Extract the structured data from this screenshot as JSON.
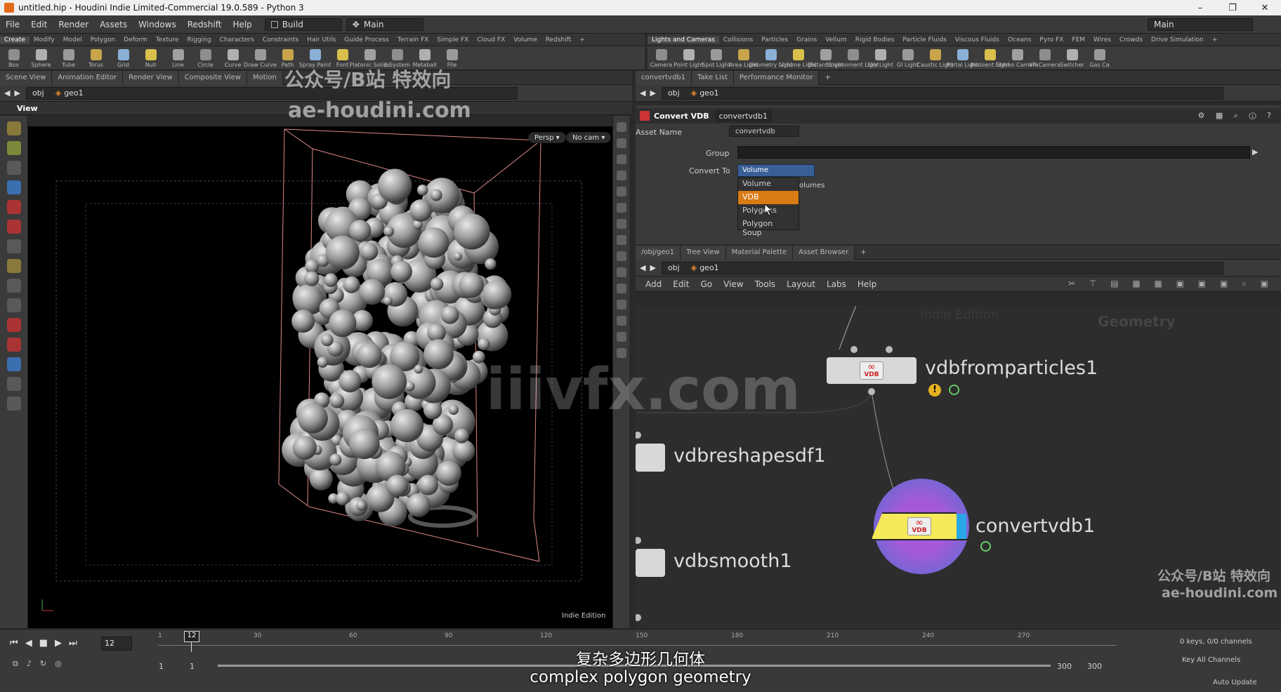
{
  "window": {
    "title": "untitled.hip - Houdini Indie Limited-Commercial 19.0.589 - Python 3",
    "controls": [
      "–",
      "❐",
      "✕"
    ]
  },
  "menubar": {
    "items": [
      "File",
      "Edit",
      "Render",
      "Assets",
      "Windows",
      "Redshift",
      "Help"
    ],
    "build": "Build",
    "desktop": "Main",
    "desktop_right": "Main"
  },
  "shelf_left": {
    "tabs": [
      "Create",
      "Modify",
      "Model",
      "Polygon",
      "Deform",
      "Texture",
      "Rigging",
      "Characters",
      "Constraints",
      "Hair Utils",
      "Guide Process",
      "Terrain FX",
      "Simple FX",
      "Cloud FX",
      "Volume",
      "Redshift"
    ],
    "tools": [
      "Box",
      "Sphere",
      "Tube",
      "Torus",
      "Grid",
      "Null",
      "Line",
      "Circle",
      "Curve",
      "Draw Curve",
      "Path",
      "Spray Paint",
      "Font",
      "Platonic Solids",
      "L-System",
      "Metaball",
      "File"
    ]
  },
  "shelf_right": {
    "tabs": [
      "Lights and Cameras",
      "Collisions",
      "Particles",
      "Grains",
      "Vellum",
      "Rigid Bodies",
      "Particle Fluids",
      "Viscous Fluids",
      "Oceans",
      "Pyro FX",
      "FEM",
      "Wires",
      "Crowds",
      "Drive Simulation"
    ],
    "tools": [
      "Camera",
      "Point Light",
      "Spot Light",
      "Area Light",
      "Geometry Light",
      "Volume Light",
      "Distant Light",
      "Environment Light",
      "Sky Light",
      "GI Light",
      "Caustic Light",
      "Portal Light",
      "Ambient Light",
      "Stereo Camera",
      "VR Camera",
      "Switcher",
      "Gas Ca"
    ]
  },
  "left_pane": {
    "tabs": [
      "Scene View",
      "Animation Editor",
      "Render View",
      "Composite View",
      "Motion"
    ],
    "path": [
      "obj",
      "geo1"
    ],
    "view_label": "View",
    "persp": "Persp ▾",
    "cam": "No cam ▾",
    "edition": "Indie Edition"
  },
  "param_pane": {
    "tabs": [
      "convertvdb1",
      "Take List",
      "Performance Monitor"
    ],
    "path": [
      "obj",
      "geo1"
    ],
    "node_type": "Convert VDB",
    "node_name": "convertvdb1",
    "asset_name_label": "Asset Name",
    "asset_name": "convertvdb",
    "group_label": "Group",
    "convert_to_label": "Convert To",
    "convert_to_value": "Volume",
    "hidden_text": "olumes",
    "options": [
      "Volume",
      "VDB",
      "Polygons",
      "Polygon Soup"
    ],
    "highlighted_option": "VDB",
    "highlight_color": "#d97a14"
  },
  "network_pane": {
    "tabs": [
      "/obj/geo1",
      "Tree View",
      "Material Palette",
      "Asset Browser"
    ],
    "path": [
      "obj",
      "geo1"
    ],
    "menu": [
      "Add",
      "Edit",
      "Go",
      "View",
      "Tools",
      "Layout",
      "Labs",
      "Help"
    ],
    "context_label": "Geometry",
    "faded_label": "Indie Edition",
    "nodes": [
      {
        "name": "vdbfromparticles1",
        "badge": "VDB"
      },
      {
        "name": "vdbreshapesdf1"
      },
      {
        "name": "convertvdb1",
        "badge": "VDB"
      },
      {
        "name": "vdbsmooth1"
      }
    ]
  },
  "timeline": {
    "current_frame": "12",
    "marker": "12",
    "ticks": [
      "1",
      "30",
      "60",
      "90",
      "120",
      "150",
      "180",
      "210",
      "240",
      "270"
    ],
    "start": "1",
    "start2": "1",
    "end": "300",
    "end2": "300",
    "keys": "0 keys, 0/0 channels",
    "key_all": "Key All Channels",
    "auto_update": "Auto Update"
  },
  "watermarks": {
    "top_cn": "公众号/B站 特效向",
    "top_url": "ae-houdini.com",
    "center": "iiivfx.com",
    "br_cn": "公众号/B站 特效向",
    "br_url": "ae-houdini.com"
  },
  "subtitles": {
    "cn": "复杂多边形几何体",
    "en": "complex polygon geometry"
  }
}
